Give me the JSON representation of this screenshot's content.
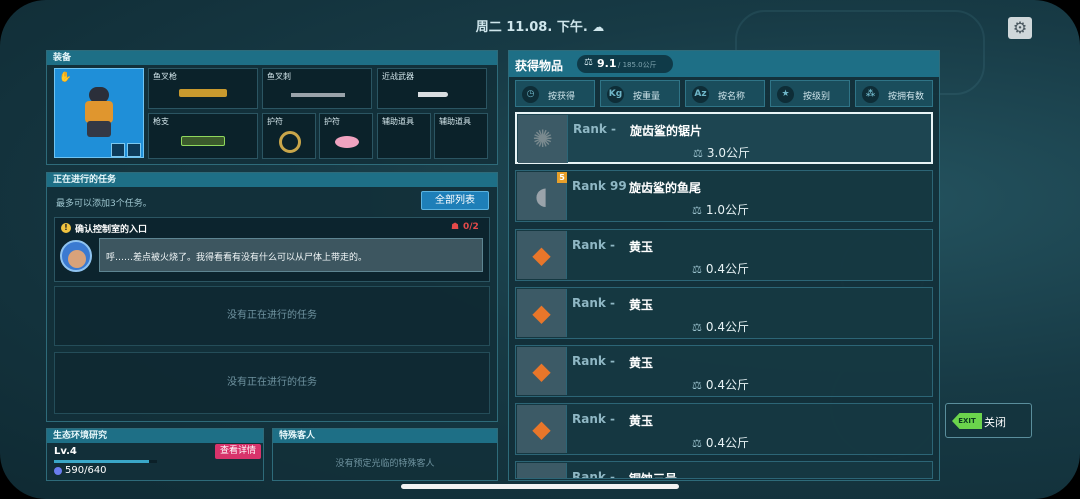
{
  "header": {
    "datetime": "周二 11.08. 下午.",
    "weather_icon": "cloudy-icon",
    "settings_icon": "gear-icon"
  },
  "equipment": {
    "title": "装备",
    "slots": [
      {
        "label": "鱼叉枪",
        "icon": "harpoon-gun-icon"
      },
      {
        "label": "鱼叉刺",
        "icon": "harpoon-spear-icon"
      },
      {
        "label": "近战武器",
        "icon": "knife-icon"
      },
      {
        "label": "枪支",
        "icon": "rifle-icon"
      },
      {
        "label": "护符",
        "icon": "bracelet-icon"
      },
      {
        "label": "护符",
        "icon": "pink-fish-charm-icon"
      },
      {
        "label": "辅助道具",
        "icon": ""
      },
      {
        "label": "辅助道具",
        "icon": ""
      }
    ]
  },
  "quests": {
    "title": "正在进行的任务",
    "limit_note": "最多可以添加3个任务。",
    "list_all_button": "全部列表",
    "active": {
      "title": "确认控制室的入口",
      "progress": "0/2",
      "dialogue": "呼……差点被火烧了。我得看看有没有什么可以从尸体上带走的。"
    },
    "empty_1": "没有正在进行的任务",
    "empty_2": "没有正在进行的任务"
  },
  "eco": {
    "title": "生态环境研究",
    "level": "Lv.4",
    "details_button": "查看详情",
    "exp": "590/640",
    "exp_fraction": 0.92
  },
  "guests": {
    "title": "特殊客人",
    "empty": "没有预定光临的特殊客人"
  },
  "loot": {
    "title": "获得物品",
    "weight": "9.1",
    "capacity": "/ 185.0公斤",
    "tabs": [
      {
        "icon": "clock-icon",
        "label": "按获得",
        "glyph": "◷"
      },
      {
        "icon": "weight-icon",
        "label": "按重量",
        "glyph": "Kg"
      },
      {
        "icon": "az-icon",
        "label": "按名称",
        "glyph": "Az"
      },
      {
        "icon": "star-icon",
        "label": "按级别",
        "glyph": "★"
      },
      {
        "icon": "stack-icon",
        "label": "按拥有数",
        "glyph": "⁂"
      }
    ],
    "items": [
      {
        "rank": "Rank -",
        "name": "旋齿鲨的锯片",
        "weight": "3.0公斤",
        "badge": "",
        "glyph": "✺",
        "selected": true
      },
      {
        "rank": "Rank 99",
        "name": "旋齿鲨的鱼尾",
        "weight": "1.0公斤",
        "badge": "5",
        "glyph": "◖",
        "selected": false
      },
      {
        "rank": "Rank -",
        "name": "黄玉",
        "weight": "0.4公斤",
        "badge": "",
        "glyph": "◆",
        "selected": false
      },
      {
        "rank": "Rank -",
        "name": "黄玉",
        "weight": "0.4公斤",
        "badge": "",
        "glyph": "◆",
        "selected": false
      },
      {
        "rank": "Rank -",
        "name": "黄玉",
        "weight": "0.4公斤",
        "badge": "",
        "glyph": "◆",
        "selected": false
      },
      {
        "rank": "Rank -",
        "name": "黄玉",
        "weight": "0.4公斤",
        "badge": "",
        "glyph": "◆",
        "selected": false
      },
      {
        "rank": "Rank -",
        "name": "铜蚀三号",
        "weight": "",
        "badge": "",
        "glyph": "◆",
        "selected": false
      }
    ]
  },
  "exit": {
    "icon_text": "EXIT",
    "label": "关闭"
  }
}
